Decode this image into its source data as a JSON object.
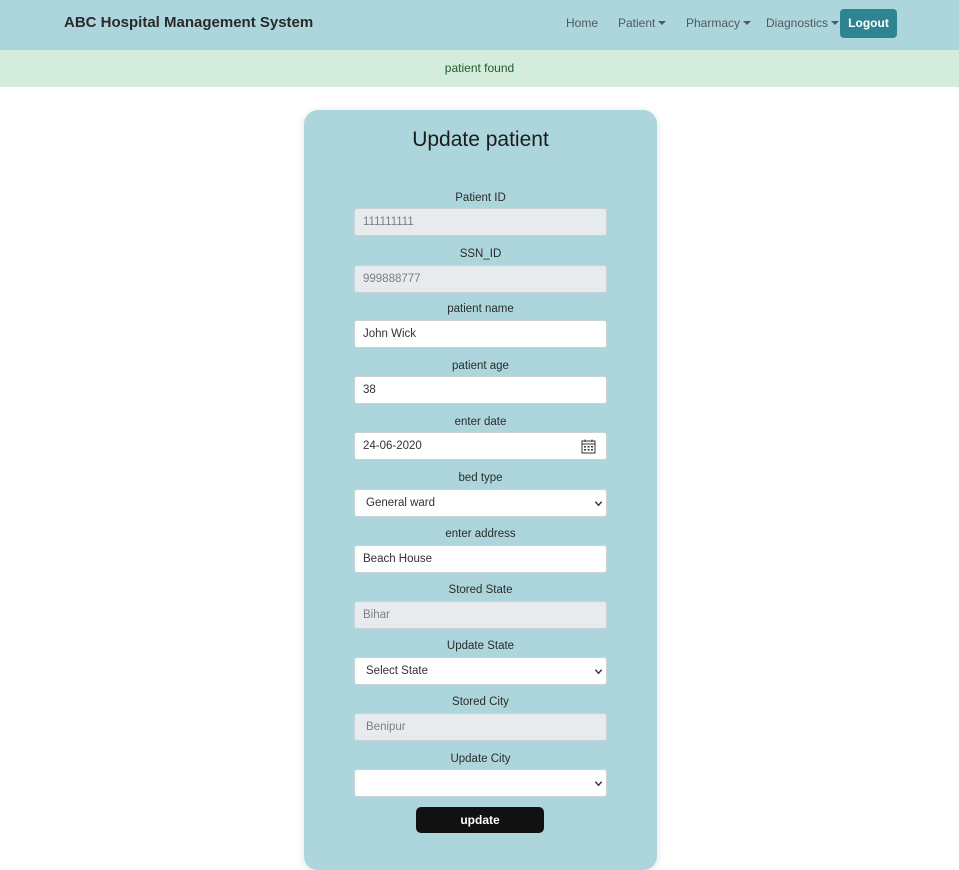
{
  "navbar": {
    "brand": "ABC Hospital Management System",
    "home": "Home",
    "patient": "Patient",
    "pharmacy": "Pharmacy",
    "diagnostics": "Diagnostics",
    "logout": "Logout"
  },
  "alert": {
    "message": "patient found"
  },
  "form": {
    "title": "Update patient",
    "patient_id": {
      "label": "Patient ID",
      "value": "111111111"
    },
    "ssn_id": {
      "label": "SSN_ID",
      "value": "999888777"
    },
    "patient_name": {
      "label": "patient name",
      "value": "John Wick"
    },
    "patient_age": {
      "label": "patient age",
      "value": "38"
    },
    "enter_date": {
      "label": "enter date",
      "value": "24-06-2020",
      "icon": "calendar-icon"
    },
    "bed_type": {
      "label": "bed type",
      "selected": "General ward"
    },
    "address": {
      "label": "enter address",
      "value": "Beach House"
    },
    "stored_state": {
      "label": "Stored State",
      "value": "Bihar"
    },
    "update_state": {
      "label": "Update State",
      "selected": "Select State"
    },
    "stored_city": {
      "label": "Stored City",
      "value": "Benipur"
    },
    "update_city": {
      "label": "Update City",
      "selected": ""
    },
    "submit": "update"
  },
  "colors": {
    "navbar_bg": "#acd6dc",
    "card_bg": "#acd6dc",
    "logout_bg": "#2e8591",
    "alert_bg": "#d4ecdb",
    "alert_text": "#1f5e2c",
    "update_bg": "#111111"
  }
}
